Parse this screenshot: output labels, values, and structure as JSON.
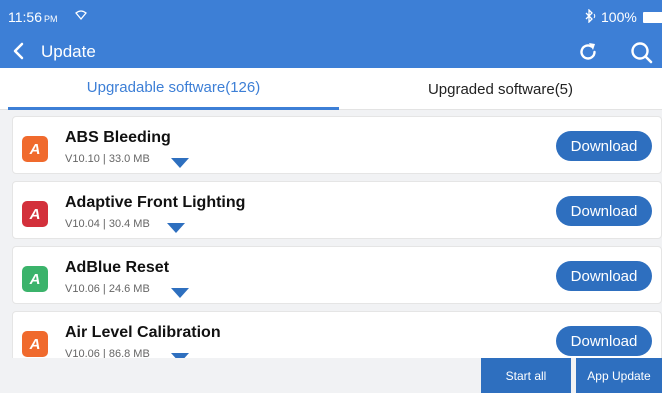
{
  "status_bar": {
    "time": "11:56",
    "ampm": "PM",
    "battery": "100%"
  },
  "header": {
    "title": "Update"
  },
  "tabs": [
    {
      "label": "Upgradable software(126)",
      "active": true
    },
    {
      "label": "Upgraded software(5)",
      "active": false
    }
  ],
  "software": [
    {
      "name": "ABS Bleeding",
      "meta": "V10.10 | 33.0 MB",
      "icon_letter": "A",
      "icon_color": "#f06a2d",
      "action": "Download"
    },
    {
      "name": "Adaptive Front Lighting",
      "meta": "V10.04 | 30.4 MB",
      "icon_letter": "A",
      "icon_color": "#d3303b",
      "action": "Download"
    },
    {
      "name": "AdBlue Reset",
      "meta": "V10.06 | 24.6 MB",
      "icon_letter": "A",
      "icon_color": "#3bb36b",
      "action": "Download"
    },
    {
      "name": "Air Level Calibration",
      "meta": "V10.06 | 86.8 MB",
      "icon_letter": "A",
      "icon_color": "#f06a2d",
      "action": "Download"
    }
  ],
  "footer": {
    "start_all": "Start all",
    "app_update": "App Update"
  },
  "colors": {
    "primary": "#3d7fd6",
    "button": "#2e6fbf"
  }
}
